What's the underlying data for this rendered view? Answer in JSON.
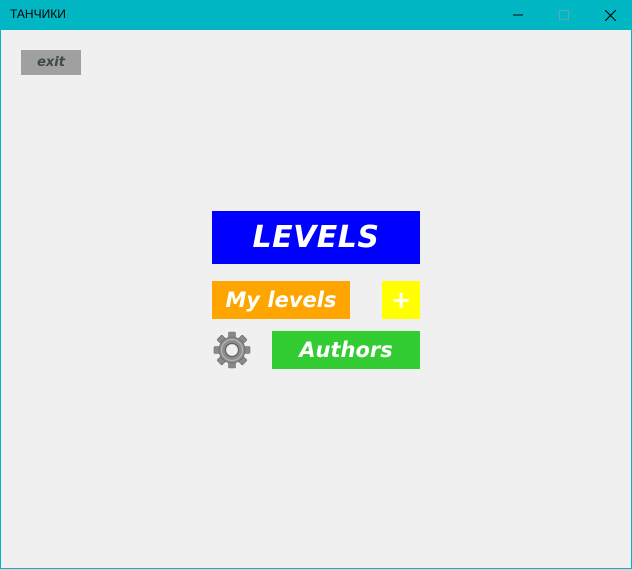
{
  "window": {
    "title": "ТАНЧИКИ",
    "accent": "#00b7c3"
  },
  "menu": {
    "exit_label": "exit",
    "levels_label": "LEVELS",
    "my_levels_label": "My levels",
    "add_label": "+",
    "authors_label": "Authors",
    "settings_icon": "gear-icon"
  },
  "colors": {
    "levels": "#0000ff",
    "my_levels": "#ffa500",
    "add": "#ffff00",
    "authors": "#33cc33",
    "exit": "#a0a0a0"
  }
}
